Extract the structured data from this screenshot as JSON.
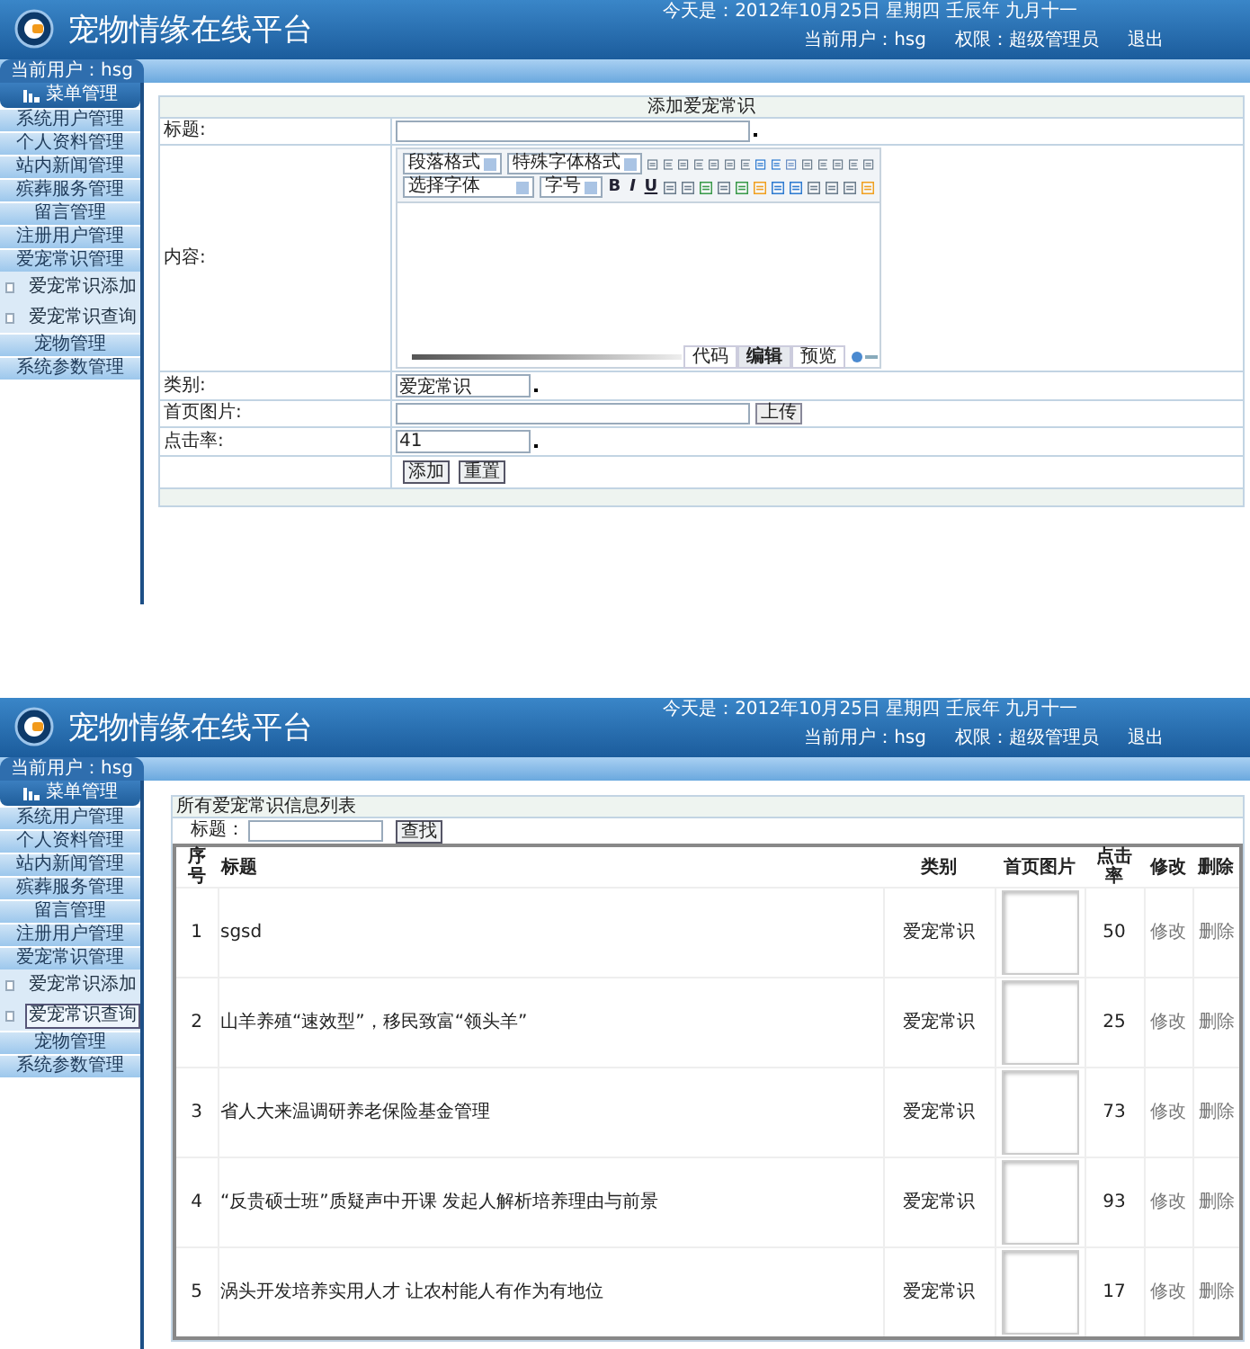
{
  "add_screen": {
    "header": {
      "title": "宠物情缘在线平台",
      "date": "今天是：2012年10月25日 星期四 壬辰年 九月十一",
      "user": "当前用户：hsg",
      "role": "权限：超级管理员",
      "logout": "退出"
    },
    "sidebar": {
      "user": "当前用户：hsg",
      "menu_title": "菜单管理",
      "items": [
        {
          "label": "系统用户管理",
          "kind": "item",
          "selected": false
        },
        {
          "label": "个人资料管理",
          "kind": "item",
          "selected": false
        },
        {
          "label": "站内新闻管理",
          "kind": "item",
          "selected": false
        },
        {
          "label": "殡葬服务管理",
          "kind": "item",
          "selected": false
        },
        {
          "label": "留言管理",
          "kind": "item",
          "selected": false
        },
        {
          "label": "注册用户管理",
          "kind": "item",
          "selected": false
        },
        {
          "label": "爱宠常识管理",
          "kind": "item",
          "selected": false
        },
        {
          "label": "爱宠常识添加",
          "kind": "sub",
          "selected": false
        },
        {
          "label": "爱宠常识查询",
          "kind": "sub",
          "selected": false
        },
        {
          "label": "宠物管理",
          "kind": "item",
          "selected": false
        },
        {
          "label": "系统参数管理",
          "kind": "item",
          "selected": false
        }
      ]
    },
    "form": {
      "title": "添加爱宠常识",
      "fields": [
        {
          "label": "标题:",
          "kind": "text",
          "required": true
        },
        {
          "label": "内容:",
          "kind": "editor",
          "selects_row1": [
            "段落格式",
            "特殊字体格式"
          ],
          "selects_row2": [
            "选择字体",
            "字号"
          ],
          "format_buttons": [
            "B",
            "I",
            "U"
          ],
          "tabs": [
            {
              "label": "代码",
              "selected": false
            },
            {
              "label": "编辑",
              "selected": true
            },
            {
              "label": "预览",
              "selected": false
            }
          ]
        },
        {
          "label": "类别:",
          "kind": "short",
          "value": "爱宠常识",
          "required": true
        },
        {
          "label": "首页图片:",
          "kind": "upload",
          "button": "上传"
        },
        {
          "label": "点击率:",
          "kind": "short",
          "value": "41",
          "required": true
        }
      ],
      "buttons": [
        "添加",
        "重置"
      ]
    }
  },
  "list_screen": {
    "header": {
      "title": "宠物情缘在线平台",
      "date": "今天是：2012年10月25日 星期四 壬辰年 九月十一",
      "user": "当前用户：hsg",
      "role": "权限：超级管理员",
      "logout": "退出"
    },
    "sidebar": {
      "user": "当前用户：hsg",
      "menu_title": "菜单管理",
      "items": [
        {
          "label": "系统用户管理",
          "kind": "item",
          "selected": false
        },
        {
          "label": "个人资料管理",
          "kind": "item",
          "selected": false
        },
        {
          "label": "站内新闻管理",
          "kind": "item",
          "selected": false
        },
        {
          "label": "殡葬服务管理",
          "kind": "item",
          "selected": false
        },
        {
          "label": "留言管理",
          "kind": "item",
          "selected": false
        },
        {
          "label": "注册用户管理",
          "kind": "item",
          "selected": false
        },
        {
          "label": "爱宠常识管理",
          "kind": "item",
          "selected": false
        },
        {
          "label": "爱宠常识添加",
          "kind": "sub",
          "selected": false
        },
        {
          "label": "爱宠常识查询",
          "kind": "sub",
          "selected": true
        },
        {
          "label": "宠物管理",
          "kind": "item",
          "selected": false
        },
        {
          "label": "系统参数管理",
          "kind": "item",
          "selected": false
        }
      ]
    },
    "list": {
      "title": "所有爱宠常识信息列表",
      "search_label": "标题：",
      "search_button": "查找",
      "columns": [
        "序号",
        "标题",
        "类别",
        "首页图片",
        "点击率",
        "修改",
        "删除"
      ],
      "rows": [
        {
          "no": "1",
          "title": "sgsd",
          "category": "爱宠常识",
          "clicks": "50",
          "edit": "修改",
          "delete": "删除"
        },
        {
          "no": "2",
          "title": "山羊养殖“速效型”，移民致富“领头羊”",
          "category": "爱宠常识",
          "clicks": "25",
          "edit": "修改",
          "delete": "删除"
        },
        {
          "no": "3",
          "title": "省人大来温调研养老保险基金管理",
          "category": "爱宠常识",
          "clicks": "73",
          "edit": "修改",
          "delete": "删除"
        },
        {
          "no": "4",
          "title": "“反贵硕士班”质疑声中开课 发起人解析培养理由与前景",
          "category": "爱宠常识",
          "clicks": "93",
          "edit": "修改",
          "delete": "删除"
        },
        {
          "no": "5",
          "title": "涡头开发培养实用人才 让农村能人有作为有地位",
          "category": "爱宠常识",
          "clicks": "17",
          "edit": "修改",
          "delete": "删除"
        }
      ]
    }
  }
}
